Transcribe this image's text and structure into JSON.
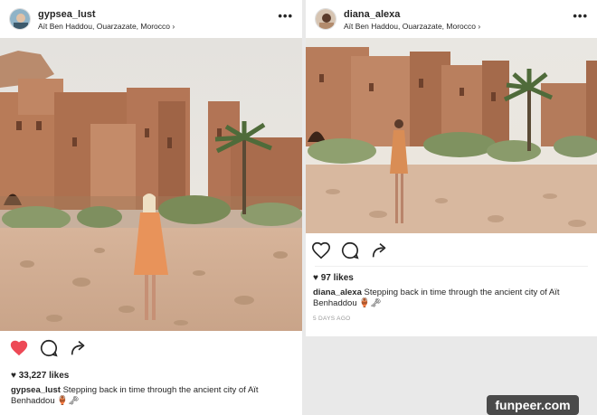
{
  "posts": [
    {
      "username": "gypsea_lust",
      "location": "Aït Ben Haddou, Ouarzazate, Morocco",
      "chevron": "›",
      "more_glyph": "•••",
      "liked": true,
      "likes_text": "33,227 likes",
      "caption_user": "gypsea_lust",
      "caption_text": "Stepping back in time through the ancient city of Aït Benhaddou 🏺🗝",
      "time": ""
    },
    {
      "username": "diana_alexa",
      "location": "Aït Ben Haddou, Ouarzazate, Morocco",
      "chevron": "›",
      "more_glyph": "•••",
      "liked": false,
      "likes_text": "97 likes",
      "caption_user": "diana_alexa",
      "caption_text": "Stepping back in time through the ancient city of Aït Benhaddou 🏺🗝",
      "time": "5 DAYS AGO"
    }
  ],
  "icons": {
    "like": "heart-icon",
    "comment": "comment-icon",
    "share": "share-icon",
    "likes_heart": "small-heart-icon"
  },
  "colors": {
    "liked_red": "#ed4956",
    "text": "#262626",
    "kasbah": "#b8805e",
    "sky": "#e9e6e1"
  },
  "watermark": "funpeer.com"
}
